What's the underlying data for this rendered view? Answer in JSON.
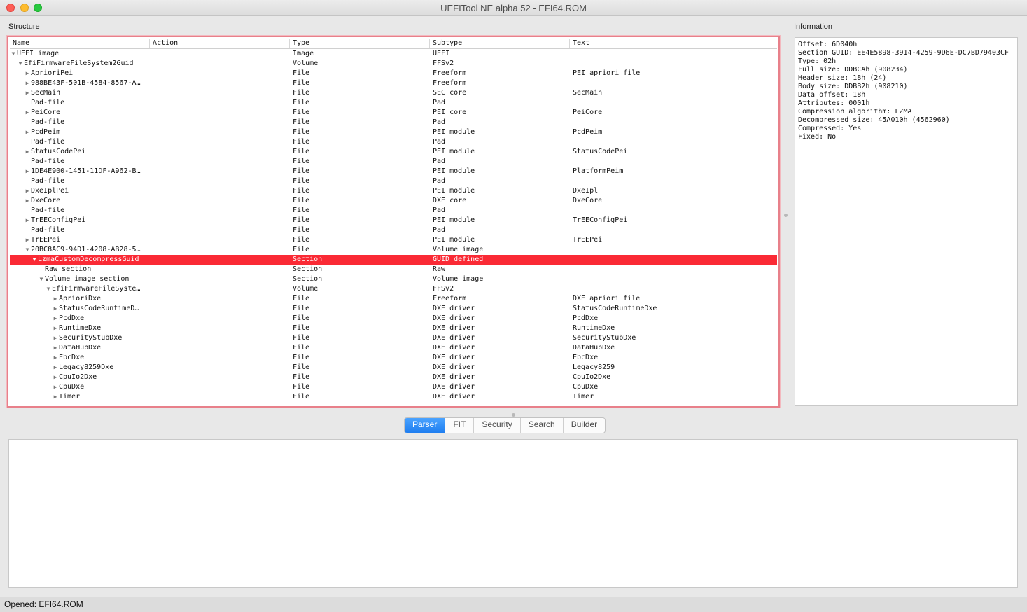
{
  "window": {
    "title": "UEFITool NE alpha 52 - EFI64.ROM"
  },
  "labels": {
    "structure": "Structure",
    "information": "Information"
  },
  "tree": {
    "columns": [
      "Name",
      "Action",
      "Type",
      "Subtype",
      "Text"
    ],
    "rows": [
      {
        "depth": 0,
        "toggle": "down",
        "name": "UEFI image",
        "type": "Image",
        "subtype": "UEFI",
        "text": ""
      },
      {
        "depth": 1,
        "toggle": "down",
        "name": "EfiFirmwareFileSystem2Guid",
        "type": "Volume",
        "subtype": "FFSv2",
        "text": ""
      },
      {
        "depth": 2,
        "toggle": "right",
        "name": "AprioriPei",
        "type": "File",
        "subtype": "Freeform",
        "text": "PEI apriori file"
      },
      {
        "depth": 2,
        "toggle": "right",
        "name": "988BE43F-501B-4584-8567-A…",
        "type": "File",
        "subtype": "Freeform",
        "text": ""
      },
      {
        "depth": 2,
        "toggle": "right",
        "name": "SecMain",
        "type": "File",
        "subtype": "SEC core",
        "text": "SecMain"
      },
      {
        "depth": 2,
        "toggle": "",
        "name": "Pad-file",
        "type": "File",
        "subtype": "Pad",
        "text": ""
      },
      {
        "depth": 2,
        "toggle": "right",
        "name": "PeiCore",
        "type": "File",
        "subtype": "PEI core",
        "text": "PeiCore"
      },
      {
        "depth": 2,
        "toggle": "",
        "name": "Pad-file",
        "type": "File",
        "subtype": "Pad",
        "text": ""
      },
      {
        "depth": 2,
        "toggle": "right",
        "name": "PcdPeim",
        "type": "File",
        "subtype": "PEI module",
        "text": "PcdPeim"
      },
      {
        "depth": 2,
        "toggle": "",
        "name": "Pad-file",
        "type": "File",
        "subtype": "Pad",
        "text": ""
      },
      {
        "depth": 2,
        "toggle": "right",
        "name": "StatusCodePei",
        "type": "File",
        "subtype": "PEI module",
        "text": "StatusCodePei"
      },
      {
        "depth": 2,
        "toggle": "",
        "name": "Pad-file",
        "type": "File",
        "subtype": "Pad",
        "text": ""
      },
      {
        "depth": 2,
        "toggle": "right",
        "name": "1DE4E900-1451-11DF-A962-B…",
        "type": "File",
        "subtype": "PEI module",
        "text": "PlatformPeim"
      },
      {
        "depth": 2,
        "toggle": "",
        "name": "Pad-file",
        "type": "File",
        "subtype": "Pad",
        "text": ""
      },
      {
        "depth": 2,
        "toggle": "right",
        "name": "DxeIplPei",
        "type": "File",
        "subtype": "PEI module",
        "text": "DxeIpl"
      },
      {
        "depth": 2,
        "toggle": "right",
        "name": "DxeCore",
        "type": "File",
        "subtype": "DXE core",
        "text": "DxeCore"
      },
      {
        "depth": 2,
        "toggle": "",
        "name": "Pad-file",
        "type": "File",
        "subtype": "Pad",
        "text": ""
      },
      {
        "depth": 2,
        "toggle": "right",
        "name": "TrEEConfigPei",
        "type": "File",
        "subtype": "PEI module",
        "text": "TrEEConfigPei"
      },
      {
        "depth": 2,
        "toggle": "",
        "name": "Pad-file",
        "type": "File",
        "subtype": "Pad",
        "text": ""
      },
      {
        "depth": 2,
        "toggle": "right",
        "name": "TrEEPei",
        "type": "File",
        "subtype": "PEI module",
        "text": "TrEEPei"
      },
      {
        "depth": 2,
        "toggle": "down",
        "name": "20BC8AC9-94D1-4208-AB28-5…",
        "type": "File",
        "subtype": "Volume image",
        "text": ""
      },
      {
        "depth": 3,
        "toggle": "down",
        "name": "LzmaCustomDecompressGuid",
        "type": "Section",
        "subtype": "GUID defined",
        "text": "",
        "selected": true
      },
      {
        "depth": 4,
        "toggle": "",
        "name": "Raw section",
        "type": "Section",
        "subtype": "Raw",
        "text": ""
      },
      {
        "depth": 4,
        "toggle": "down",
        "name": "Volume image section",
        "type": "Section",
        "subtype": "Volume image",
        "text": ""
      },
      {
        "depth": 5,
        "toggle": "down",
        "name": "EfiFirmwareFileSyste…",
        "type": "Volume",
        "subtype": "FFSv2",
        "text": ""
      },
      {
        "depth": 6,
        "toggle": "right",
        "name": "AprioriDxe",
        "type": "File",
        "subtype": "Freeform",
        "text": "DXE apriori file"
      },
      {
        "depth": 6,
        "toggle": "right",
        "name": "StatusCodeRuntimeD…",
        "type": "File",
        "subtype": "DXE driver",
        "text": "StatusCodeRuntimeDxe"
      },
      {
        "depth": 6,
        "toggle": "right",
        "name": "PcdDxe",
        "type": "File",
        "subtype": "DXE driver",
        "text": "PcdDxe"
      },
      {
        "depth": 6,
        "toggle": "right",
        "name": "RuntimeDxe",
        "type": "File",
        "subtype": "DXE driver",
        "text": "RuntimeDxe"
      },
      {
        "depth": 6,
        "toggle": "right",
        "name": "SecurityStubDxe",
        "type": "File",
        "subtype": "DXE driver",
        "text": "SecurityStubDxe"
      },
      {
        "depth": 6,
        "toggle": "right",
        "name": "DataHubDxe",
        "type": "File",
        "subtype": "DXE driver",
        "text": "DataHubDxe"
      },
      {
        "depth": 6,
        "toggle": "right",
        "name": "EbcDxe",
        "type": "File",
        "subtype": "DXE driver",
        "text": "EbcDxe"
      },
      {
        "depth": 6,
        "toggle": "right",
        "name": "Legacy8259Dxe",
        "type": "File",
        "subtype": "DXE driver",
        "text": "Legacy8259"
      },
      {
        "depth": 6,
        "toggle": "right",
        "name": "CpuIo2Dxe",
        "type": "File",
        "subtype": "DXE driver",
        "text": "CpuIo2Dxe"
      },
      {
        "depth": 6,
        "toggle": "right",
        "name": "CpuDxe",
        "type": "File",
        "subtype": "DXE driver",
        "text": "CpuDxe"
      },
      {
        "depth": 6,
        "toggle": "right",
        "name": "Timer",
        "type": "File",
        "subtype": "DXE driver",
        "text": "Timer"
      }
    ]
  },
  "information": {
    "lines": [
      "Offset: 6D040h",
      "Section GUID: EE4E5898-3914-4259-9D6E-DC7BD79403CF",
      "Type: 02h",
      "Full size: DDBCAh (908234)",
      "Header size: 18h (24)",
      "Body size: DDBB2h (908210)",
      "Data offset: 18h",
      "Attributes: 0001h",
      "Compression algorithm: LZMA",
      "Decompressed size: 45A010h (4562960)",
      "Compressed: Yes",
      "Fixed: No"
    ]
  },
  "tabs": [
    {
      "label": "Parser",
      "active": true
    },
    {
      "label": "FIT",
      "active": false
    },
    {
      "label": "Security",
      "active": false
    },
    {
      "label": "Search",
      "active": false
    },
    {
      "label": "Builder",
      "active": false
    }
  ],
  "status": {
    "text": "Opened: EFI64.ROM"
  },
  "colors": {
    "selection": "#fa2a35",
    "tab_active": "#1f7ef0",
    "focus_border": "#e8808a"
  }
}
